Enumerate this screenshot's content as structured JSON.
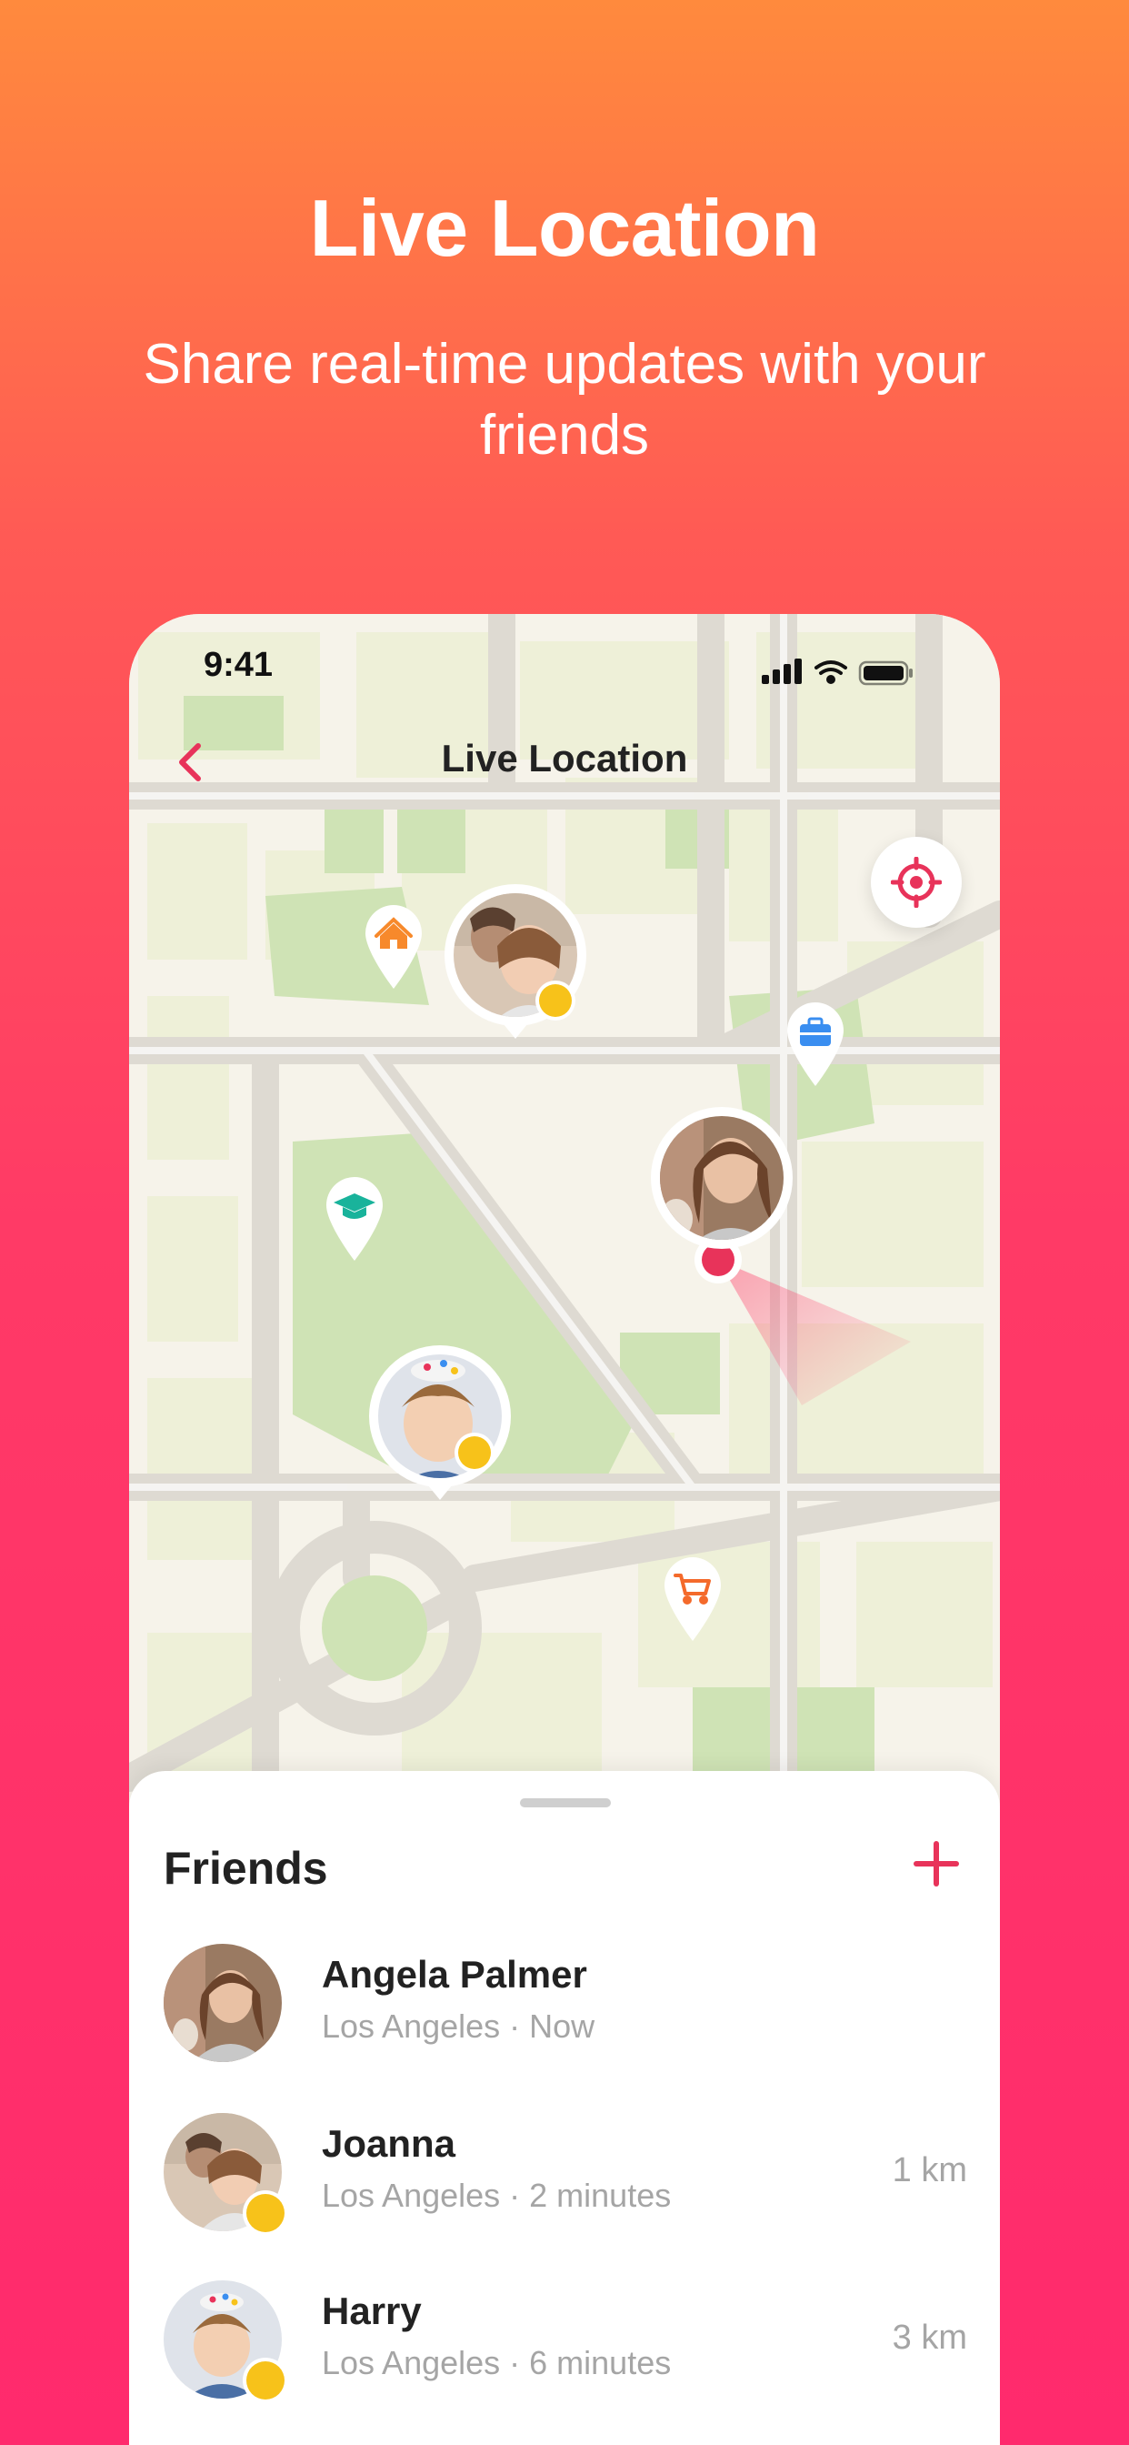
{
  "hero": {
    "title": "Live Location",
    "subtitle": "Share real-time updates with your friends"
  },
  "status_bar": {
    "time": "9:41",
    "icons": [
      "cellular-signal-icon",
      "wifi-icon",
      "battery-icon"
    ]
  },
  "nav": {
    "title": "Live Location",
    "back_icon": "chevron-left-icon"
  },
  "map": {
    "locate_icon": "crosshair-icon",
    "places": [
      {
        "name": "home",
        "icon": "home-icon",
        "color": "#f7892b"
      },
      {
        "name": "work",
        "icon": "briefcase-icon",
        "color": "#3a8ef0"
      },
      {
        "name": "school",
        "icon": "graduation-cap-icon",
        "color": "#19b39b"
      },
      {
        "name": "shop",
        "icon": "shopping-cart-icon",
        "color": "#f46a2b"
      }
    ],
    "friends_on_map": [
      "Joanna",
      "Angela Palmer",
      "Harry"
    ]
  },
  "friends": {
    "title": "Friends",
    "add_icon": "plus-icon",
    "items": [
      {
        "name": "Angela Palmer",
        "location": "Los Angeles · Now",
        "distance": ""
      },
      {
        "name": "Joanna",
        "location": "Los Angeles · 2 minutes",
        "distance": "1 km"
      },
      {
        "name": "Harry",
        "location": "Los Angeles · 6 minutes",
        "distance": "3 km"
      }
    ]
  },
  "colors": {
    "accent": "#e8335a",
    "badge": "#f7c21a",
    "park": "#cfe3b5",
    "block": "#eef0d8",
    "road": "#d9d6cf"
  }
}
